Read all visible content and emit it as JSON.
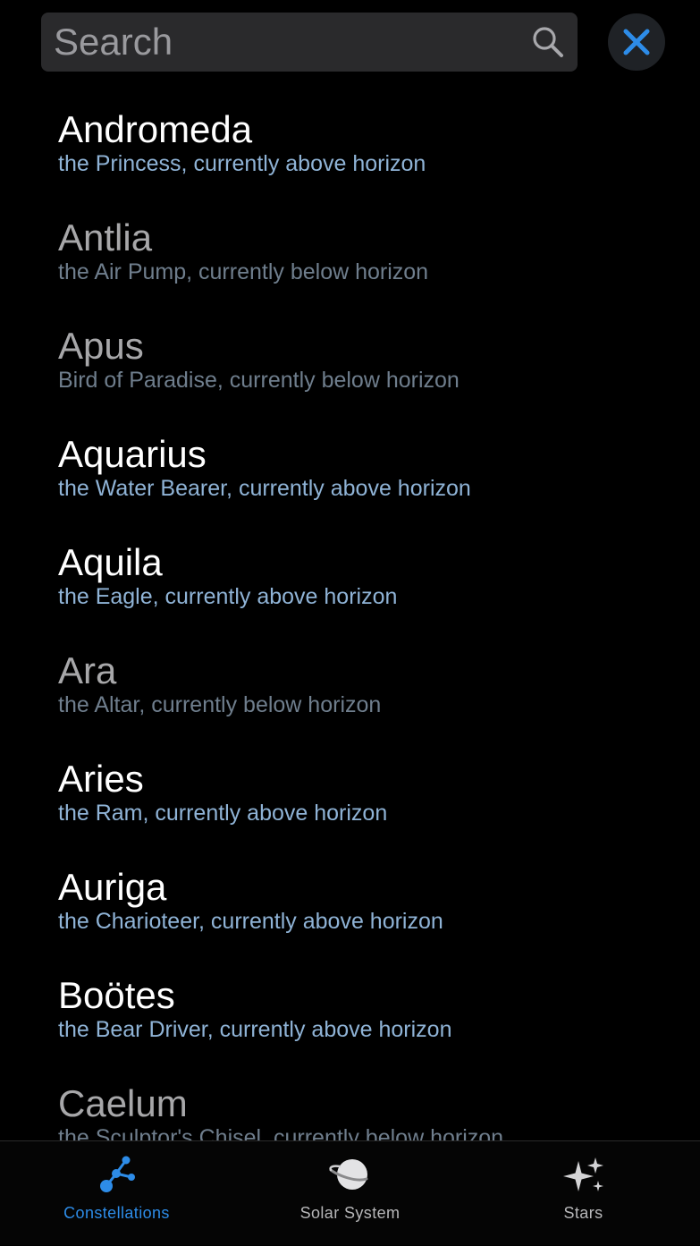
{
  "search": {
    "placeholder": "Search"
  },
  "constellations": [
    {
      "name": "Andromeda",
      "description": "the Princess, currently above horizon",
      "state": "above"
    },
    {
      "name": "Antlia",
      "description": "the Air Pump, currently below horizon",
      "state": "below"
    },
    {
      "name": "Apus",
      "description": "Bird of Paradise, currently below horizon",
      "state": "below"
    },
    {
      "name": "Aquarius",
      "description": "the Water Bearer, currently above horizon",
      "state": "above"
    },
    {
      "name": "Aquila",
      "description": "the Eagle, currently above horizon",
      "state": "above"
    },
    {
      "name": "Ara",
      "description": "the Altar, currently below horizon",
      "state": "below"
    },
    {
      "name": "Aries",
      "description": "the Ram, currently above horizon",
      "state": "above"
    },
    {
      "name": "Auriga",
      "description": "the Charioteer, currently above horizon",
      "state": "above"
    },
    {
      "name": "Boötes",
      "description": "the Bear Driver, currently above horizon",
      "state": "above"
    },
    {
      "name": "Caelum",
      "description": "the Sculptor's Chisel, currently below horizon",
      "state": "below"
    }
  ],
  "tabs": [
    {
      "label": "Constellations",
      "icon": "constellation-icon",
      "active": true
    },
    {
      "label": "Solar System",
      "icon": "planet-icon",
      "active": false
    },
    {
      "label": "Stars",
      "icon": "stars-icon",
      "active": false
    }
  ],
  "colors": {
    "accent": "#2d8ce8",
    "close_icon": "#2d8ce8",
    "above_name": "#ffffff",
    "above_desc": "#8fb3d6",
    "below_name": "#a7a7a9",
    "below_desc": "#6f7e8d"
  }
}
